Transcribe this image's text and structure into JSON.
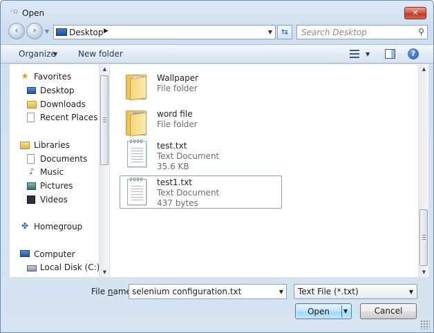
{
  "window": {
    "title": "Open",
    "title_icon": "open-dialog-icon",
    "close_label": "✕"
  },
  "nav": {
    "back_icon": "back-arrow-icon",
    "forward_icon": "forward-arrow-icon",
    "address": "Desktop",
    "address_icon": "desktop-icon",
    "refresh_icon": "refresh-icon",
    "search_placeholder": "Search Desktop"
  },
  "toolbar": {
    "organize": "Organize",
    "new_folder": "New folder",
    "views_icon": "change-view-icon",
    "preview_icon": "preview-pane-icon",
    "help_icon": "help-icon",
    "help_glyph": "?"
  },
  "sidebar": {
    "items": [
      {
        "label": "Favorites",
        "icon": "favorites-star-icon"
      },
      {
        "label": "Desktop",
        "icon": "desktop-icon"
      },
      {
        "label": "Downloads",
        "icon": "downloads-folder-icon"
      },
      {
        "label": "Recent Places",
        "icon": "recent-places-icon"
      },
      {
        "label": "Libraries",
        "icon": "libraries-icon"
      },
      {
        "label": "Documents",
        "icon": "documents-icon"
      },
      {
        "label": "Music",
        "icon": "music-icon"
      },
      {
        "label": "Pictures",
        "icon": "pictures-icon"
      },
      {
        "label": "Videos",
        "icon": "videos-icon"
      },
      {
        "label": "Homegroup",
        "icon": "homegroup-icon"
      },
      {
        "label": "Computer",
        "icon": "computer-icon"
      },
      {
        "label": "Local Disk (C:)",
        "icon": "local-disk-icon"
      }
    ]
  },
  "files": [
    {
      "name": "Wallpaper",
      "type": "File folder",
      "size": "",
      "icon": "folder-icon"
    },
    {
      "name": "word file",
      "type": "File folder",
      "size": "",
      "icon": "folder-icon"
    },
    {
      "name": "test.txt",
      "type": "Text Document",
      "size": "35.6 KB",
      "icon": "text-document-icon"
    },
    {
      "name": "test1.txt",
      "type": "Text Document",
      "size": "437 bytes",
      "icon": "text-document-icon"
    }
  ],
  "footer": {
    "file_name_label_pre": "File ",
    "file_name_label_u": "n",
    "file_name_label_post": "ame:",
    "file_name_value": "selenium configuration.txt",
    "file_type": "Text File (*.txt)",
    "open": "Open",
    "cancel": "Cancel"
  },
  "colors": {
    "accent": "#3c7fb1",
    "close": "#c0331f",
    "chrome": "#cfdeee"
  }
}
